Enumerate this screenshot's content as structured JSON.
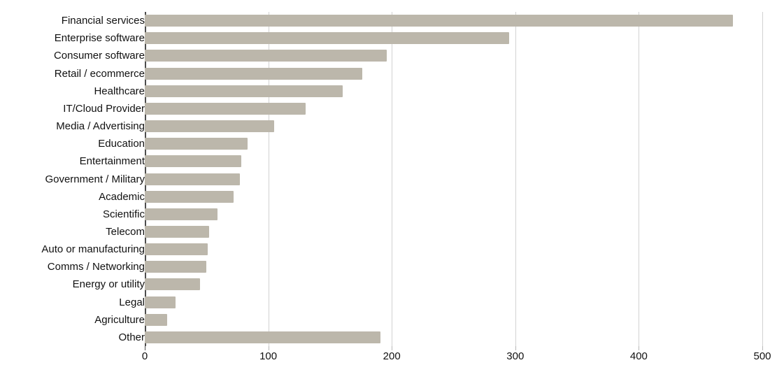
{
  "chart_data": {
    "type": "bar",
    "orientation": "horizontal",
    "title": "",
    "subtitle": "",
    "xlabel": "",
    "ylabel": "",
    "xlim": [
      0,
      500
    ],
    "xticks": [
      0,
      100,
      200,
      300,
      400,
      500
    ],
    "xtick_labels": [
      "0",
      "100",
      "200",
      "300",
      "400",
      "500"
    ],
    "grid": "vertical",
    "legend": "none",
    "bar_color": "#bcb7ab",
    "axis_color": "#4d4d4d",
    "grid_color": "#d2d2d2",
    "text_color": "#111111",
    "categories": [
      "Financial services",
      "Enterprise software",
      "Consumer software",
      "Retail / ecommerce",
      "Healthcare",
      "IT/Cloud Provider",
      "Media / Advertising",
      "Education",
      "Entertainment",
      "Government / Military",
      "Academic",
      "Scientific",
      "Telecom",
      "Auto or manufacturing",
      "Comms / Networking",
      "Energy or utility",
      "Legal",
      "Agriculture",
      "Other"
    ],
    "values": [
      476,
      295,
      196,
      176,
      160,
      130,
      105,
      83,
      78,
      77,
      72,
      59,
      52,
      51,
      50,
      45,
      25,
      18,
      191
    ]
  }
}
